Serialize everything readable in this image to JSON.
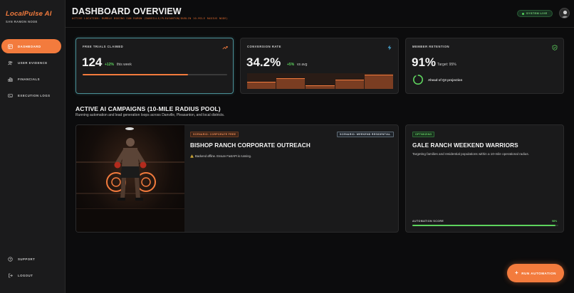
{
  "app": {
    "brand": "LocalPulse AI",
    "node": "SAN RAMON NODE"
  },
  "sidebar": {
    "items": [
      {
        "label": "DASHBOARD",
        "icon": "dashboard-icon",
        "active": true
      },
      {
        "label": "USER EVIDENCE",
        "icon": "users-icon",
        "active": false
      },
      {
        "label": "FINANCIALS",
        "icon": "bar-chart-icon",
        "active": false
      },
      {
        "label": "EXECUTION LOGS",
        "icon": "logs-icon",
        "active": false
      }
    ],
    "bottom": [
      {
        "label": "SUPPORT",
        "icon": "help-icon"
      },
      {
        "label": "LOGOUT",
        "icon": "logout-icon"
      }
    ]
  },
  "header": {
    "title": "DASHBOARD OVERVIEW",
    "subtitle": "ACTIVE LOCATION: RUMBLE BOXING SAN RAMON (DANVILLE/PLEASANTON/DUBLIN 10-MILE RADIUS NODE)",
    "status": "SYSTEM LIVE"
  },
  "metrics": {
    "trials": {
      "label": "FREE TRIALS CLAIMED",
      "value": "124",
      "delta": "+12%",
      "note": "this week",
      "progress": 0.73
    },
    "conversion": {
      "label": "CONVERSION RATE",
      "value": "34.2%",
      "delta": "+5%",
      "note": "vs avg",
      "bars": [
        0.45,
        0.7,
        0.25,
        0.6,
        0.9
      ]
    },
    "retention": {
      "label": "MEMBER RETENTION",
      "value": "91%",
      "note": "Target: 95%",
      "ring_note": "Ahead of Q3 projection",
      "ring_fraction": 0.91
    }
  },
  "section": {
    "title": "ACTIVE AI CAMPAIGNS (10-MILE RADIUS POOL)",
    "subtitle": "Running automation and lead generation loops across Danville, Pleasanton, and local districts."
  },
  "campaign1": {
    "tag1": "SCENARIO: CORPORATE FREE",
    "tag2": "SCENARIO: WEEKEND RESIDENTIAL",
    "title": "BISHOP RANCH CORPORATE OUTREACH",
    "warning": "Backend offline. Ensure FastAPI is running."
  },
  "campaign2": {
    "tag": "OPTIMIZING",
    "title": "GALE RANCH WEEKEND WARRIORS",
    "desc": "Targeting families and residential populations within a 10-mile operational radius.",
    "score_label": "AUTOMATION SCORE",
    "score_value": "98%",
    "score": 0.98
  },
  "actions": {
    "run": "RUN AUTOMATION"
  },
  "colors": {
    "accent": "#f37b3d",
    "success": "#5ed45e",
    "conversion_icon": "#4fb7e8"
  }
}
